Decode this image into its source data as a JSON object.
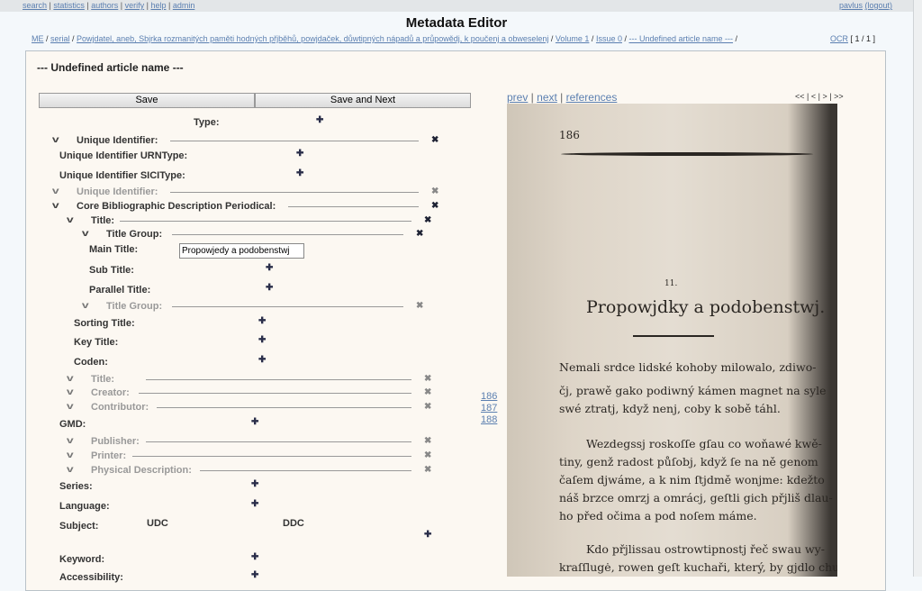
{
  "topnav": [
    "search",
    "statistics",
    "authors",
    "verify",
    "help",
    "admin"
  ],
  "user": {
    "name": "pavlus",
    "logout": "(logout)"
  },
  "title": "Metadata Editor",
  "breadcrumb": [
    "ME",
    "serial",
    "Powjdatel, aneb, Sbjrka rozmanitých paměti hodných přjběhů, powjdaček, důwtipných nápadů a průpowědj, k poučenj a obweselenj",
    "Volume 1",
    "Issue 0",
    "--- Undefined article name ---"
  ],
  "ocr": {
    "label": "OCR",
    "pages": "[ 1 / 1 ]"
  },
  "article_title": "--- Undefined article name ---",
  "buttons": {
    "save": "Save",
    "save_next": "Save and Next"
  },
  "form": {
    "rows": [
      {
        "label": "Type:",
        "control": "add"
      },
      {
        "label": "Unique Identifier:",
        "control": "remove",
        "expanded": true
      },
      {
        "label": "Unique Identifier URNType:",
        "control": "add"
      },
      {
        "label": "Unique Identifier SICIType:",
        "control": "add"
      },
      {
        "label": "Unique Identifier:",
        "control": "remove",
        "disabled": true,
        "expanded": true
      },
      {
        "label": "Core Bibliographic Description Periodical:",
        "control": "remove",
        "expanded": true
      },
      {
        "label": "Title:",
        "control": "remove",
        "expanded": true
      },
      {
        "label": "Title Group:",
        "control": "remove",
        "expanded": true
      },
      {
        "label": "Main Title:",
        "value": "Propowjedy a podobenstwj"
      },
      {
        "label": "Sub Title:",
        "control": "add"
      },
      {
        "label": "Parallel Title:",
        "control": "add"
      },
      {
        "label": "Title Group:",
        "control": "remove",
        "disabled": true,
        "expanded": true
      },
      {
        "label": "Sorting Title:",
        "control": "add"
      },
      {
        "label": "Key Title:",
        "control": "add"
      },
      {
        "label": "Coden:",
        "control": "add"
      },
      {
        "label": "Title:",
        "control": "remove",
        "disabled": true,
        "expanded": true
      },
      {
        "label": "Creator:",
        "control": "remove",
        "disabled": true,
        "expanded": true
      },
      {
        "label": "Contributor:",
        "control": "remove",
        "disabled": true,
        "expanded": true
      },
      {
        "label": "GMD:",
        "control": "add"
      },
      {
        "label": "Publisher:",
        "control": "remove",
        "disabled": true,
        "expanded": true
      },
      {
        "label": "Printer:",
        "control": "remove",
        "disabled": true,
        "expanded": true
      },
      {
        "label": "Physical Description:",
        "control": "remove",
        "disabled": true,
        "expanded": true
      },
      {
        "label": "Series:",
        "control": "add"
      },
      {
        "label": "Language:",
        "control": "add"
      },
      {
        "label": "Subject:",
        "control": "add",
        "columns": [
          "UDC",
          "DDC"
        ]
      },
      {
        "label": "Keyword:",
        "control": "add"
      },
      {
        "label": "Accessibility:",
        "control": "add"
      }
    ]
  },
  "viewer": {
    "links": [
      "prev",
      "next",
      "references"
    ],
    "pager": [
      "<<",
      "<",
      ">",
      ">>"
    ],
    "pages": [
      "186",
      "187",
      "188"
    ]
  },
  "scan": {
    "page_number": "186",
    "section": "11.",
    "heading": "Propowjdky a podobenstwj.",
    "lines": [
      "Nemali srdce lidské kohoby milowalo, zdiwo-",
      "čj, prawě gako podiwný kámen magnet na syle",
      "swé ztratj, když nenj, coby k sobě táhl.",
      "Wezdegssj roskoſſe gſau co woňawé kwě-",
      "tiny, genž radost půſobj, když ſe na ně genom",
      "čaſem djwáme, a k nim ſtjdmě wonjme: kdežto",
      "náš brzce omrzj a omrácj, geſtli gich přjliš dlau-",
      "ho před očima a pod noſem máme.",
      "Kdo přjlissau ostrowtipnostj řeč swau wy-",
      "kraſſlugė, rowen geſt kuchaři, který, by gjdlo chut-"
    ]
  }
}
